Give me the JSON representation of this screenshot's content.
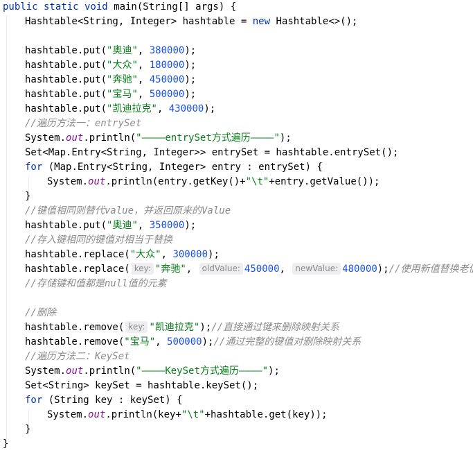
{
  "code": {
    "l01": {
      "kw1": "public static void",
      "sig": " main(String[] args) {"
    },
    "l02": {
      "t1": "Hashtable<String, Integer> hashtable = ",
      "kw": "new",
      "t2": " Hashtable<>();"
    },
    "l04": {
      "t1": "hashtable.put(",
      "s": "\"奥迪\"",
      "t2": ", ",
      "n": "380000",
      "t3": ");"
    },
    "l05": {
      "t1": "hashtable.put(",
      "s": "\"大众\"",
      "t2": ", ",
      "n": "180000",
      "t3": ");"
    },
    "l06": {
      "t1": "hashtable.put(",
      "s": "\"奔驰\"",
      "t2": ", ",
      "n": "450000",
      "t3": ");"
    },
    "l07": {
      "t1": "hashtable.put(",
      "s": "\"宝马\"",
      "t2": ", ",
      "n": "500000",
      "t3": ");"
    },
    "l08": {
      "t1": "hashtable.put(",
      "s": "\"凯迪拉克\"",
      "t2": ", ",
      "n": "430000",
      "t3": ");"
    },
    "l09": {
      "c": "//遍历方法一：entrySet"
    },
    "l10": {
      "t1": "System.",
      "f": "out",
      "t2": ".println(",
      "s": "\"————entrySet方式遍历————\"",
      "t3": ");"
    },
    "l11": {
      "t1": "Set<Map.Entry<String, Integer>> entrySet = hashtable.entrySet();"
    },
    "l12": {
      "kw": "for",
      "t1": " (Map.Entry<String, Integer> entry : entrySet) {"
    },
    "l13": {
      "t1": "System.",
      "f": "out",
      "t2": ".println(entry.getKey()+",
      "s": "\"\\t\"",
      "t3": "+entry.getValue());"
    },
    "l14": {
      "t1": "}"
    },
    "l15": {
      "c": "//键值相同则替代value，并返回原来的Value"
    },
    "l16": {
      "t1": "hashtable.put(",
      "s": "\"奥迪\"",
      "t2": ", ",
      "n": "350000",
      "t3": ");"
    },
    "l17": {
      "c": "//存入键相同的键值对相当于替换"
    },
    "l18": {
      "t1": "hashtable.replace(",
      "s": "\"大众\"",
      "t2": ", ",
      "n": "300000",
      "t3": ");"
    },
    "l19": {
      "t1": "hashtable.replace(",
      "h1": "key:",
      "s": "\"奔驰\"",
      "t2": ", ",
      "h2": "oldValue:",
      "n1": "450000",
      "t3": ", ",
      "h3": "newValue:",
      "n2": "480000",
      "t4": ");",
      "c": "//使用新值替换老值"
    },
    "l20": {
      "c": "//存储键和值都是null值的元素"
    },
    "l22": {
      "c": "//删除"
    },
    "l23": {
      "t1": "hashtable.remove(",
      "h": "key:",
      "s": "\"凯迪拉克\"",
      "t2": ");",
      "c": "//直接通过键来删除映射关系"
    },
    "l24": {
      "t1": "hashtable.remove(",
      "s": "\"宝马\"",
      "t2": ", ",
      "n": "500000",
      "t3": ");",
      "c": "//通过完整的键值对删除映射关系"
    },
    "l25": {
      "c": "//遍历方法二：KeySet"
    },
    "l26": {
      "t1": "System.",
      "f": "out",
      "t2": ".println(",
      "s": "\"————KeySet方式遍历————\"",
      "t3": ");"
    },
    "l27": {
      "t1": "Set<String> keySet = hashtable.keySet();"
    },
    "l28": {
      "kw": "for",
      "t1": " (String key : keySet) {"
    },
    "l29": {
      "t1": "System.",
      "f": "out",
      "t2": ".println(key+",
      "s": "\"\\t\"",
      "t3": "+hashtable.get(key));"
    },
    "l30": {
      "t1": "}"
    },
    "l31": {
      "t1": "}"
    }
  },
  "colors": {
    "keyword": "#0033b3",
    "string": "#067d17",
    "number": "#1750eb",
    "field": "#871094",
    "comment": "#8c8c8c",
    "hint_bg": "#eeeef0"
  }
}
